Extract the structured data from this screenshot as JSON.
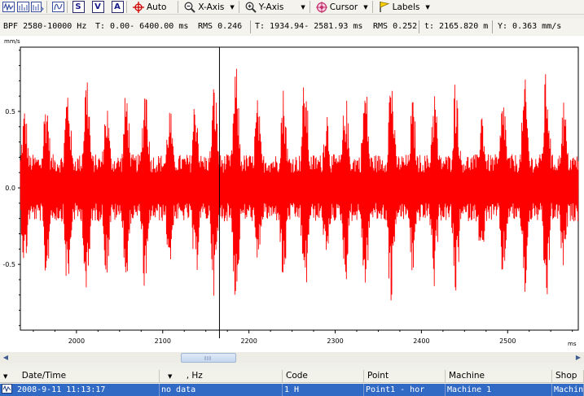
{
  "toolbar": {
    "auto_label": "Auto",
    "x_axis_label": "X-Axis",
    "y_axis_label": "Y-Axis",
    "cursor_label": "Cursor",
    "labels_label": "Labels",
    "s_icon_text": "S",
    "v_icon_text": "V",
    "a_icon_text": "A",
    "caret": "▼"
  },
  "infobar": {
    "filter": "BPF 2580-10000 Hz",
    "time_range": "T: 0.00- 6400.00 ms",
    "rms_total": "RMS 0.246",
    "cursor_range": "T: 1934.94- 2581.93 ms",
    "rms_range": "RMS 0.252",
    "cursor_t": "t: 2165.820 m",
    "cursor_y": "Y:  0.363 mm/s"
  },
  "chart_data": {
    "type": "line",
    "title": "",
    "ylabel": "mm/s",
    "xlabel": "ms",
    "x_ticks": [
      2000,
      2100,
      2200,
      2300,
      2400,
      2500
    ],
    "y_ticks": [
      -0.5,
      0.0,
      0.5
    ],
    "xlim": [
      1934.94,
      2581.93
    ],
    "ylim": [
      -0.93,
      0.92
    ],
    "cursor_x": 2165.82,
    "cursor_y": 0.363,
    "series": [
      {
        "color": "#ff0000",
        "description": "band-pass vibration waveform, amplitude mostly within ±0.45 with peaks near ±0.8"
      }
    ]
  },
  "colors": {
    "signal": "#ff0000",
    "cursor": "#000000",
    "selection": "#316ac5"
  },
  "table": {
    "columns": [
      "Date/Time",
      ", Hz",
      "Code",
      "Point",
      "Machine",
      "Shop"
    ],
    "rows": [
      [
        "2008-9-11 11:13:17",
        "no data",
        "1 H",
        "Point1 - hor",
        "Machine 1",
        "Machin"
      ]
    ]
  },
  "icons": [
    "waveform-icon",
    "spectrum-icon",
    "spectrum-3d-icon",
    "orbit-icon",
    "s-icon",
    "v-icon",
    "a-icon",
    "auto-crosshair-icon",
    "zoom-x-icon",
    "zoom-y-icon",
    "cursor-target-icon",
    "labels-flag-icon"
  ]
}
